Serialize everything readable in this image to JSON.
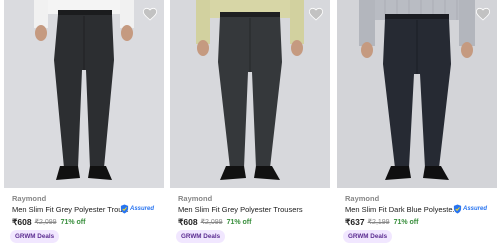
{
  "products": [
    {
      "brand": "Raymond",
      "title": "Men Slim Fit Grey Polyester Trou...",
      "price": "₹608",
      "mrp": "₹2,099",
      "discount": "71% off",
      "deal": "GRWM Deals",
      "assured": "Assured",
      "pants_color": "#2c2e31",
      "shirt_color": "#f4f4f4"
    },
    {
      "brand": "Raymond",
      "title": "Men Slim Fit Grey Polyester Trousers",
      "price": "₹608",
      "mrp": "₹2,099",
      "discount": "71% off",
      "deal": "GRWM Deals",
      "assured": "",
      "pants_color": "#35383b",
      "shirt_color": "#d7d6a6"
    },
    {
      "brand": "Raymond",
      "title": "Men Slim Fit Dark Blue Polyeste...",
      "price": "₹637",
      "mrp": "₹2,199",
      "discount": "71% off",
      "deal": "GRWM Deals",
      "assured": "Assured",
      "pants_color": "#262a33",
      "shirt_color": "#b9bcc3"
    }
  ],
  "icons": {
    "wishlist": "heart-icon",
    "assured": "shield-icon"
  },
  "colors": {
    "discount": "#388e3c",
    "assured_blue": "#2874f0",
    "deal_bg": "#f1e7ff",
    "deal_text": "#5c2d91"
  }
}
